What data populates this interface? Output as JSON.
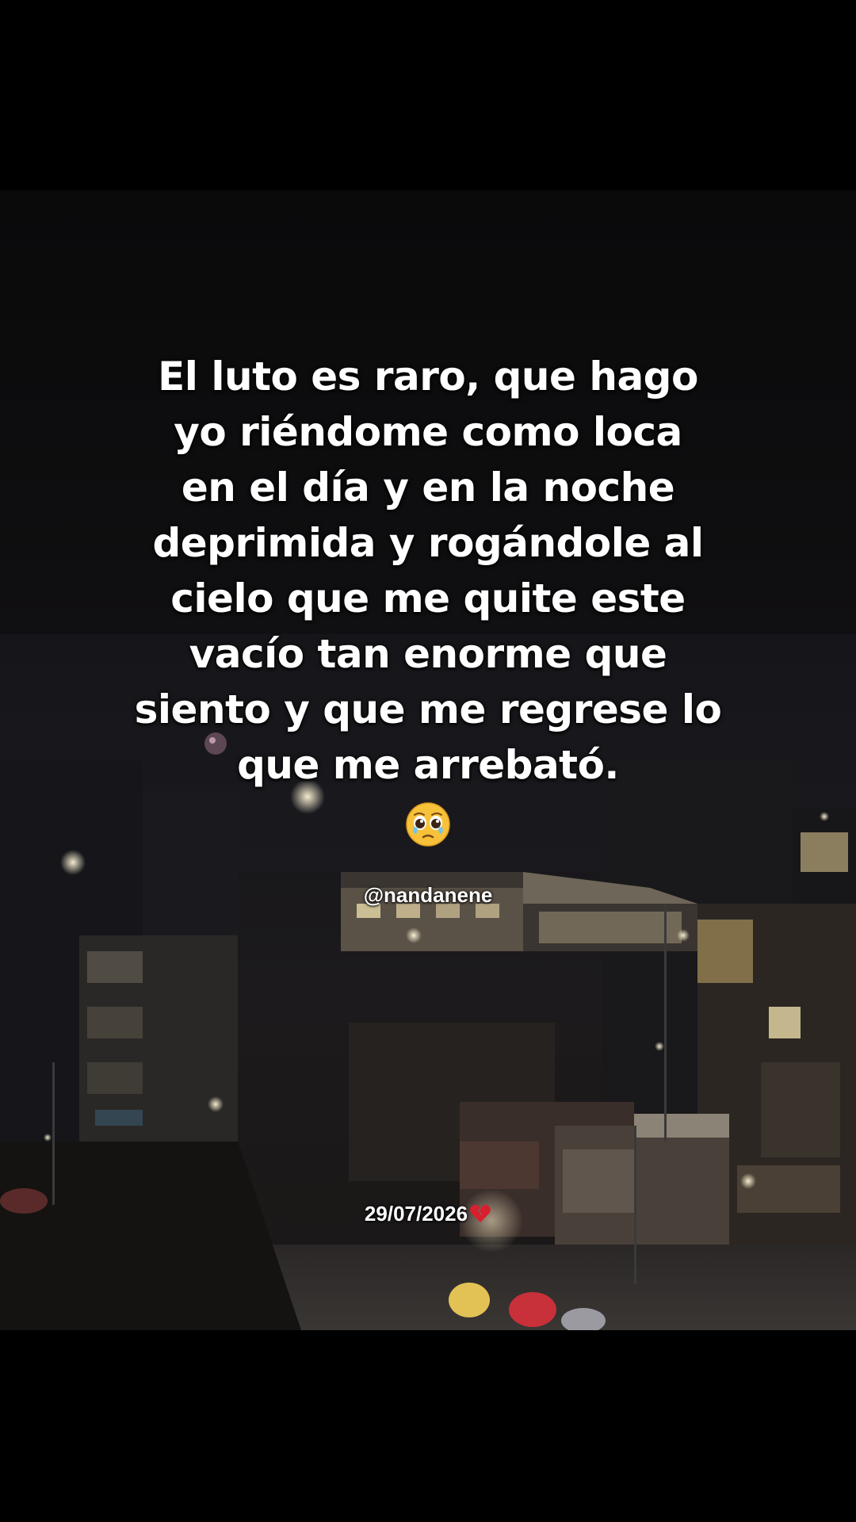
{
  "post": {
    "quote_lines": [
      "El luto es raro, que hago",
      "yo riéndome como loca",
      "en el día y en la noche",
      "deprimida y rogándole al",
      "cielo que me quite este",
      "vacío tan enorme que",
      "siento y que me regrese lo",
      "que me arrebató."
    ],
    "emoji": "pleading-face-icon",
    "handle": "@nandanene",
    "date": "29/07/2026",
    "date_emoji": "broken-heart-icon"
  },
  "colors": {
    "background": "#000000",
    "text": "#ffffff",
    "heart": "#d81f2e",
    "emoji_face": "#f7c23a"
  }
}
